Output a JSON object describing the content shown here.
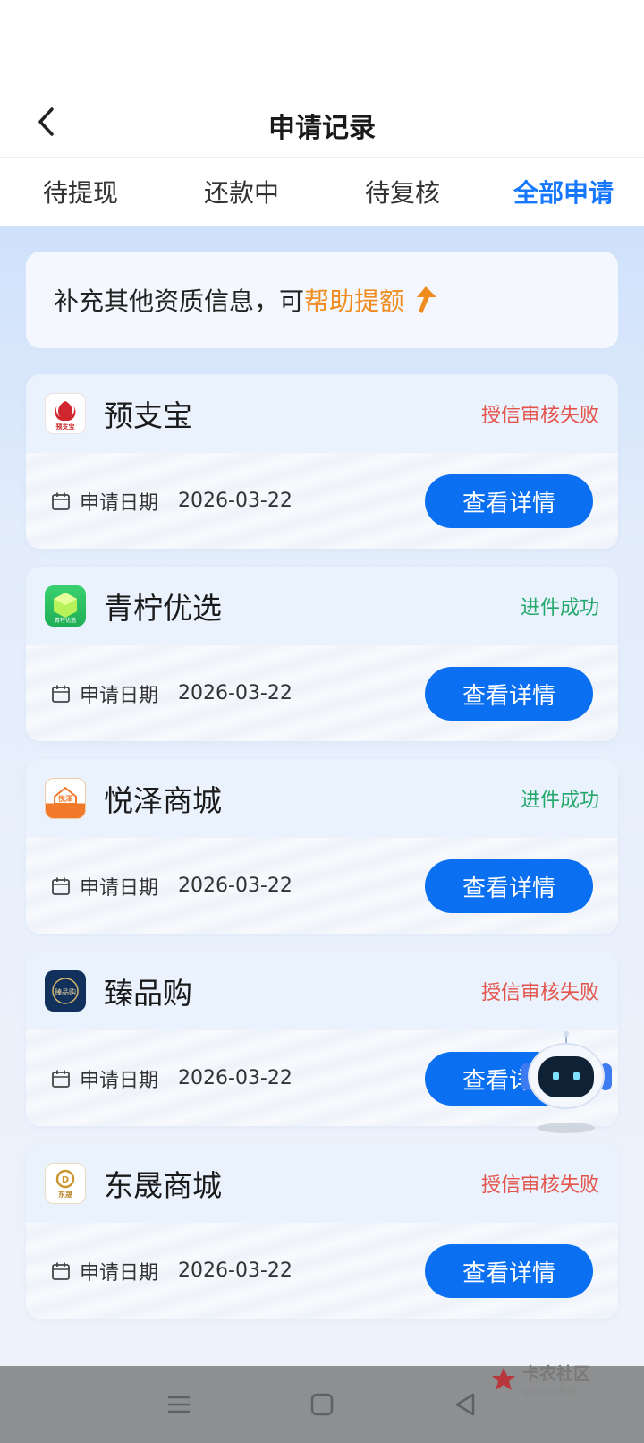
{
  "header": {
    "title": "申请记录"
  },
  "tabs": [
    {
      "label": "待提现",
      "active": false
    },
    {
      "label": "还款中",
      "active": false
    },
    {
      "label": "待复核",
      "active": false
    },
    {
      "label": "全部申请",
      "active": true
    }
  ],
  "banner": {
    "text": "补充其他资质信息，可",
    "highlight": "帮助提额"
  },
  "records": [
    {
      "name": "预支宝",
      "status": "授信审核失败",
      "status_type": "fail",
      "date_label": "申请日期",
      "date": "2026-03-22",
      "button": "查看详情",
      "logo_text": "预支宝",
      "icon": "phoenix-logo-icon"
    },
    {
      "name": "青柠优选",
      "status": "进件成功",
      "status_type": "success",
      "date_label": "申请日期",
      "date": "2026-03-22",
      "button": "查看详情",
      "logo_text": "青柠优选",
      "icon": "cube-logo-icon"
    },
    {
      "name": "悦泽商城",
      "status": "进件成功",
      "status_type": "success",
      "date_label": "申请日期",
      "date": "2026-03-22",
      "button": "查看详情",
      "logo_text": "悦泽",
      "icon": "house-logo-icon"
    },
    {
      "name": "臻品购",
      "status": "授信审核失败",
      "status_type": "fail",
      "date_label": "申请日期",
      "date": "2026-03-22",
      "button": "查看详情",
      "logo_text": "臻品购",
      "icon": "circle-logo-icon"
    },
    {
      "name": "东晟商城",
      "status": "授信审核失败",
      "status_type": "fail",
      "date_label": "申请日期",
      "date": "2026-03-22",
      "button": "查看详情",
      "logo_text": "东晟",
      "icon": "d-logo-icon"
    }
  ],
  "watermark": {
    "title": "卡农社区",
    "subtitle": "金融在线教育"
  },
  "colors": {
    "accent": "#1677ff",
    "button": "#0a6ff0",
    "fail": "#e5544b",
    "success": "#22a86a",
    "highlight": "#f08c1e"
  }
}
